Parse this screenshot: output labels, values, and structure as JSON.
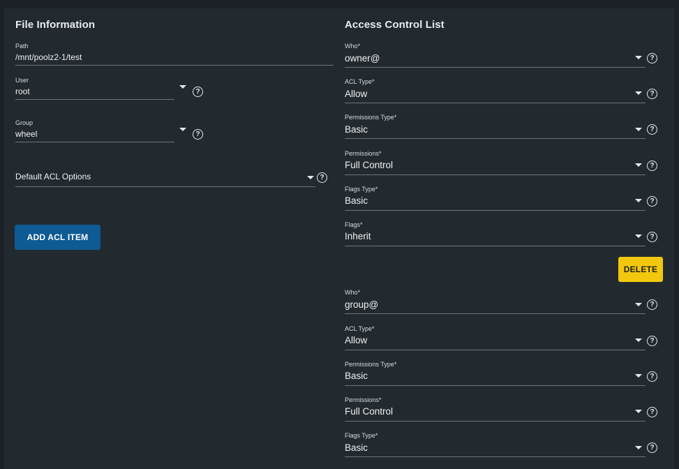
{
  "file_info": {
    "heading": "File Information",
    "path": {
      "label": "Path",
      "value": "/mnt/poolz2-1/test"
    },
    "user": {
      "label": "User",
      "value": "root"
    },
    "group": {
      "label": "Group",
      "value": "wheel"
    },
    "default_acl": {
      "value": "Default ACL Options"
    },
    "add_button": "ADD ACL ITEM"
  },
  "acl": {
    "heading": "Access Control List",
    "delete_button": "DELETE",
    "entries": [
      {
        "who": {
          "label": "Who*",
          "value": "owner@"
        },
        "acl_type": {
          "label": "ACL Type*",
          "value": "Allow"
        },
        "permissions_type": {
          "label": "Permissions Type*",
          "value": "Basic"
        },
        "permissions": {
          "label": "Permissions*",
          "value": "Full Control"
        },
        "flags_type": {
          "label": "Flags Type*",
          "value": "Basic"
        },
        "flags": {
          "label": "Flags*",
          "value": "Inherit"
        }
      },
      {
        "who": {
          "label": "Who*",
          "value": "group@"
        },
        "acl_type": {
          "label": "ACL Type*",
          "value": "Allow"
        },
        "permissions_type": {
          "label": "Permissions Type*",
          "value": "Basic"
        },
        "permissions": {
          "label": "Permissions*",
          "value": "Full Control"
        },
        "flags_type": {
          "label": "Flags Type*",
          "value": "Basic"
        }
      }
    ]
  },
  "icons": {
    "help": "help-circle-icon",
    "dropdown": "caret-down-icon"
  }
}
